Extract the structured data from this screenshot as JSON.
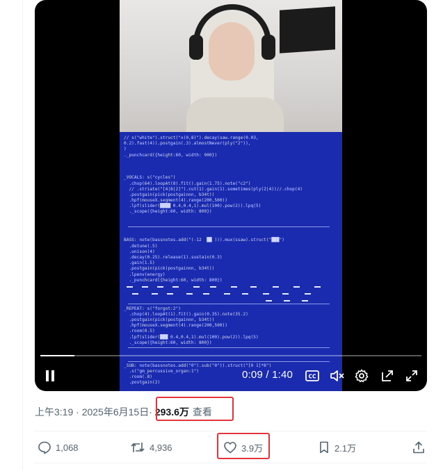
{
  "video": {
    "code_lines": [
      "// s(\"white\").struct(\"x(0,8)\").decay(saw.range(0.03,",
      "0.2).fast(4)).postgain(.3).almostNever(ply(\"2\")),",
      ")",
      "._punchcard({height:60, width: 900})",
      "",
      "",
      "",
      "_VOCALS: s(\"cycles\")",
      "  .chop(64).loopAt(8).fit().gain(1.75).note(\"c2\")",
      "  // .striate(\"[4|8|2]\").cut(1).gain(1).sometimes(ply(2|4))//.chop(4)",
      "  .postgain(pick(postgainnn, b34t))",
      "  .hpf(mouseX.segment(4).range(200,500))",
      "  .lpf(slider(████ 0.4,0.4,1).mul(100).pow(2)).lpq(5)",
      "  ._scope({height:60, width: 800})",
      "",
      "",
      "",
      "",
      "BASS: note(bassnotes.add(\"(-12  ██ ))).mux(ssaw).struct(\"███\")",
      "  .detune(.5)",
      "  .unison(4)",
      "  .decay(0.25).release(1).sustain(0.3)",
      "  .gain(1.5)",
      "  .postgain(pick(postgainnn, b34t))",
      "  .lpenv(energy)",
      "  ._punchcard({height:60, width: 800})",
      "",
      "",
      "",
      "",
      "_REPEAT: s(\"forgot:2\")",
      "  .chop(4).loopAt(1).fit().gain(0.35).note(35.2)",
      "  .postgain(pick(postgainnn, b34t))",
      "  .hpf(mouseX.segment(4).range(200,500))",
      "  .room(0.5)",
      "  .lpf(slider(███ 0.4,0.4,1).mul(100).pow(2)).lpq(5)",
      "  ._scope({height:60, width: 800})",
      "",
      "",
      "",
      "_SUB: note(bassnotes.add(\"0\").sub(\"0\")).struct(\"[0 1]*8\")",
      "  .s(\"gm_percussive_organ:1\")",
      "  .room(.8)",
      "  .postgain(2)"
    ],
    "time": "0:09 / 1:40",
    "progress_fraction": 0.09
  },
  "meta": {
    "timestamp": "上午3:19 · 2025年6月15日",
    "separator": " · ",
    "views_count": "293.6万",
    "views_label": "查看"
  },
  "actions": {
    "replies": "1,068",
    "reposts": "4,936",
    "likes": "3.9万",
    "bookmarks": "2.1万"
  },
  "colors": {
    "highlight": "#e3343b",
    "code_bg": "#1a2bb0",
    "muted_text": "#536471"
  }
}
